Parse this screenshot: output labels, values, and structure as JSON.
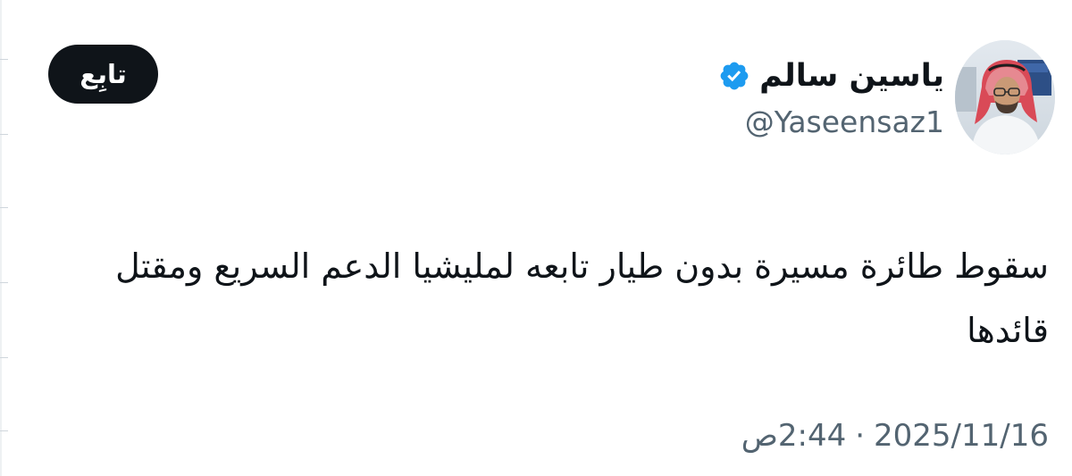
{
  "author": {
    "display_name": "ياسين سالم",
    "handle": "@Yaseensaz1",
    "verified": true,
    "verified_color": "#1d9bf0",
    "avatar_icon": "profile-photo"
  },
  "actions": {
    "follow_label": "تابِع"
  },
  "tweet": {
    "text": "سقوط طائرة مسيرة بدون طيار تابعه لمليشيا الدعم السريع ومقتل قائدها"
  },
  "timestamp": {
    "ampm": "ص",
    "time": "2:44",
    "separator": "·",
    "date": "2025/11/16"
  },
  "colors": {
    "text_primary": "#0f1419",
    "text_secondary": "#536471",
    "button_bg": "#0f1419",
    "button_text": "#ffffff"
  }
}
